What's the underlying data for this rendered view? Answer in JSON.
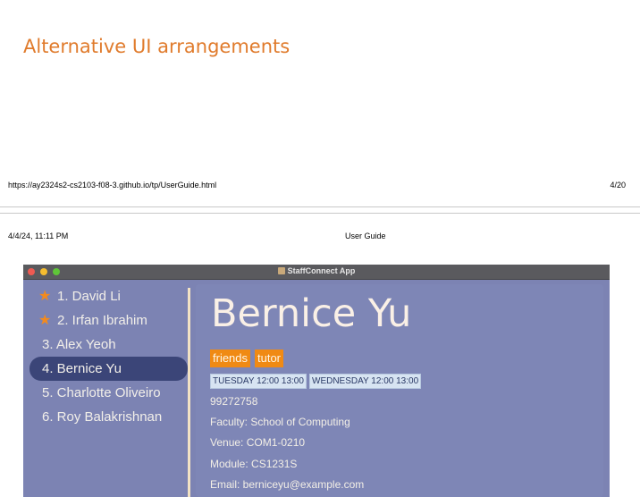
{
  "heading": "Alternative UI arrangements",
  "footer": {
    "url": "https://ay2324s2-cs2103-f08-3.github.io/tp/UserGuide.html",
    "page": "4/20"
  },
  "header": {
    "datetime": "4/4/24, 11:11 PM",
    "title": "User Guide"
  },
  "app": {
    "window_title": "StaffConnect App",
    "list": [
      {
        "label": "1.  David Li",
        "favourite": true,
        "selected": false
      },
      {
        "label": "2.  Irfan Ibrahim",
        "favourite": true,
        "selected": false
      },
      {
        "label": "3.  Alex Yeoh",
        "favourite": false,
        "selected": false
      },
      {
        "label": "4.  Bernice Yu",
        "favourite": false,
        "selected": true
      },
      {
        "label": "5.  Charlotte Oliveiro",
        "favourite": false,
        "selected": false
      },
      {
        "label": "6.  Roy Balakrishnan",
        "favourite": false,
        "selected": false
      }
    ],
    "detail": {
      "name": "Bernice Yu",
      "tags": [
        "friends",
        "tutor"
      ],
      "availability": [
        "TUESDAY 12:00 13:00",
        "WEDNESDAY 12:00 13:00"
      ],
      "phone": "99272758",
      "faculty": "Faculty:  School of Computing",
      "venue": "Venue:  COM1-0210",
      "module": "Module:  CS1231S",
      "email": "Email:  berniceyu@example.com"
    },
    "colors": {
      "accent": "#f08a14",
      "window_bg": "#7c83b3",
      "selected_bg": "#3b4578",
      "heading": "#e07b2c"
    }
  }
}
